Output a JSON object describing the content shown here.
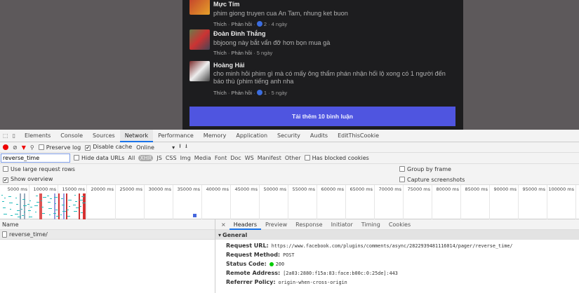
{
  "comments": [
    {
      "name": "Mực Tím",
      "text": "phim giong truyen cua An Tam, nhung ket buon",
      "like": "Thích",
      "reply": "Phản hồi",
      "reactions": "2",
      "time": "4 ngày"
    },
    {
      "name": "Đoàn Đình Thắng",
      "text": "bbjoong này bắt vẩn đỡ hơn bọn mua gà",
      "like": "Thích",
      "reply": "Phản hồi",
      "time": "5 ngày"
    },
    {
      "name": "Hoàng Hải",
      "text": "cho minh hỏi phim gì mà có mấy ông thẩm phán nhận hối lộ xong có 1 người đến báo thù (phim tiếng anh nha",
      "like": "Thích",
      "reply": "Phản hồi",
      "reactions": "1",
      "time": "5 ngày"
    }
  ],
  "load_more": "Tải thêm 10 bình luận",
  "devtools": {
    "tabs": [
      "Elements",
      "Console",
      "Sources",
      "Network",
      "Performance",
      "Memory",
      "Application",
      "Security",
      "Audits",
      "EditThisCookie"
    ],
    "toolbar": {
      "preserve_log": "Preserve log",
      "disable_cache": "Disable cache",
      "throttle": "Online"
    },
    "filter": {
      "value": "reverse_time",
      "hide_data_urls": "Hide data URLs",
      "types": [
        "All",
        "XHR",
        "JS",
        "CSS",
        "Img",
        "Media",
        "Font",
        "Doc",
        "WS",
        "Manifest",
        "Other"
      ],
      "has_blocked": "Has blocked cookies"
    },
    "options": {
      "large_rows": "Use large request rows",
      "group_by_frame": "Group by frame",
      "show_overview": "Show overview",
      "capture_screenshots": "Capture screenshots"
    },
    "ticks": [
      "5000 ms",
      "10000 ms",
      "15000 ms",
      "20000 ms",
      "25000 ms",
      "30000 ms",
      "35000 ms",
      "40000 ms",
      "45000 ms",
      "50000 ms",
      "55000 ms",
      "60000 ms",
      "65000 ms",
      "70000 ms",
      "75000 ms",
      "80000 ms",
      "85000 ms",
      "90000 ms",
      "95000 ms",
      "100000 ms"
    ],
    "name_header": "Name",
    "request": "reverse_time/",
    "detail_tabs": [
      "Headers",
      "Preview",
      "Response",
      "Initiator",
      "Timing",
      "Cookies"
    ],
    "general": {
      "title": "General",
      "rows": [
        {
          "k": "Request URL:",
          "v": "https://www.facebook.com/plugins/comments/async/2822939481116014/pager/reverse_time/"
        },
        {
          "k": "Request Method:",
          "v": "POST"
        },
        {
          "k": "Status Code:",
          "v": "200"
        },
        {
          "k": "Remote Address:",
          "v": "[2a03:2880:f15a:83:face:b00c:0:25de]:443"
        },
        {
          "k": "Referrer Policy:",
          "v": "origin-when-cross-origin"
        }
      ]
    }
  }
}
